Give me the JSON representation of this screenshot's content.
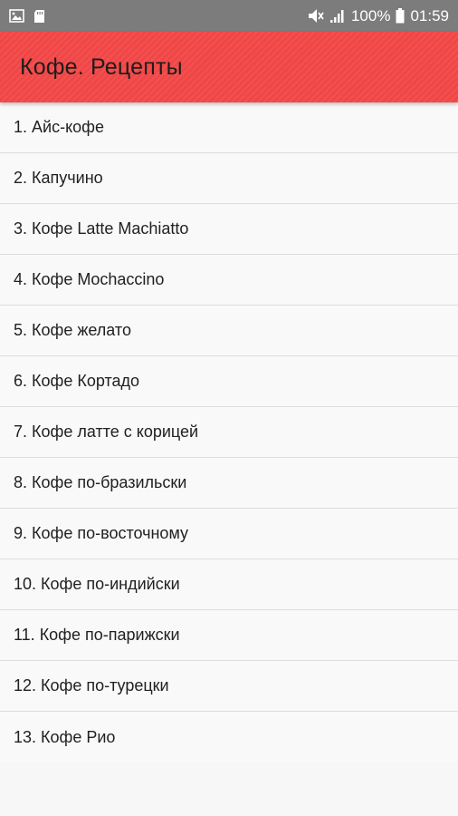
{
  "status_bar": {
    "battery_percent": "100%",
    "time": "01:59",
    "icons": [
      "image-icon",
      "sd-card-icon",
      "mute-icon",
      "signal-icon",
      "battery-icon"
    ]
  },
  "app_bar": {
    "title": "Кофе. Рецепты",
    "color": "#f14646"
  },
  "recipes": [
    "1. Айс-кофе",
    "2. Капучино",
    "3. Кофе Latte Machiatto",
    "4. Кофе Mochaccino",
    "5. Кофе желато",
    "6. Кофе Кортадо",
    "7. Кофе латте с корицей",
    "8. Кофе по-бразильски",
    "9. Кофе по-восточному",
    "10. Кофе по-индийски",
    "11. Кофе по-парижски",
    "12. Кофе по-турецки",
    "13. Кофе Рио"
  ]
}
